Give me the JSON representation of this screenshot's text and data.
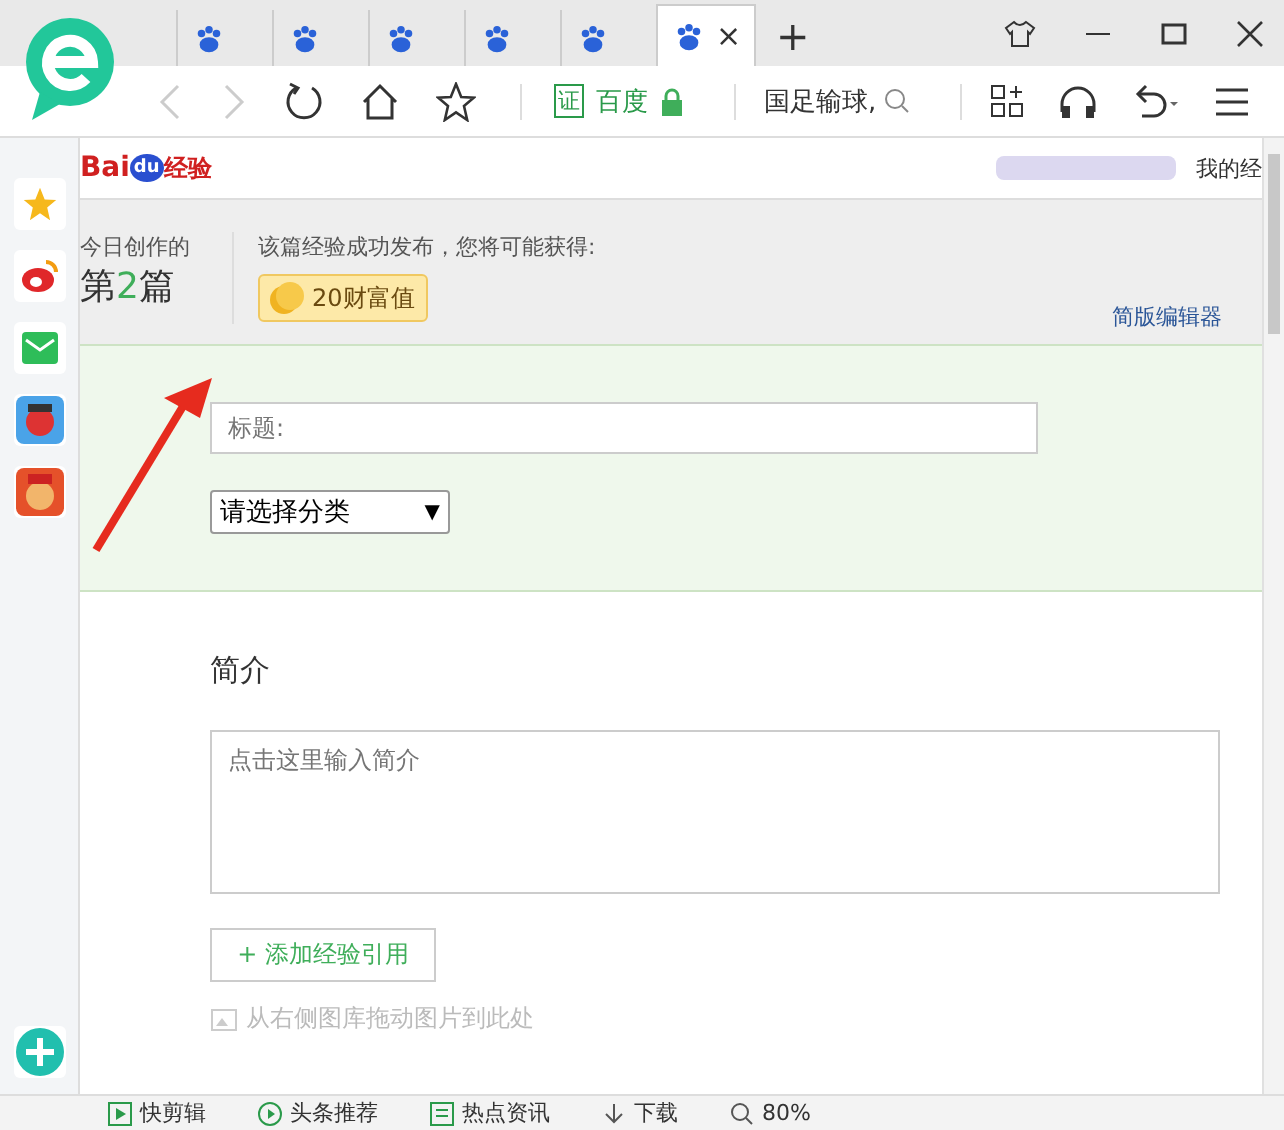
{
  "tabs": [
    {
      "selected": false
    },
    {
      "selected": false
    },
    {
      "selected": false
    },
    {
      "selected": false
    },
    {
      "selected": false
    },
    {
      "selected": true,
      "close": "×"
    }
  ],
  "new_tab": "+",
  "address": {
    "cert": "证",
    "site": "百度"
  },
  "search": {
    "value": "国足输球,"
  },
  "header": {
    "logo_text": "Bai",
    "logo_du": "du",
    "logo_suffix": "经验",
    "my_link": "我的经"
  },
  "stats": {
    "label": "今日创作的",
    "prefix": "第",
    "count": "2",
    "suffix": "篇",
    "reward_label": "该篇经验成功发布，您将可能获得:",
    "reward": "20财富值",
    "simple_editor": "简版编辑器"
  },
  "form": {
    "title_placeholder": "标题:",
    "category": "请选择分类",
    "category_arrow": "▼"
  },
  "intro": {
    "heading": "简介",
    "placeholder": "点击这里输入简介",
    "add_ref": "+ 添加经验引用",
    "drag_hint": "从右侧图库拖动图片到此处"
  },
  "status_bar": [
    {
      "kind": "app",
      "label": "快剪辑"
    },
    {
      "kind": "play",
      "label": "头条推荐"
    },
    {
      "kind": "news",
      "label": "热点资讯"
    },
    {
      "kind": "download",
      "label": "下载"
    },
    {
      "kind": "zoom",
      "label": "80%"
    }
  ]
}
